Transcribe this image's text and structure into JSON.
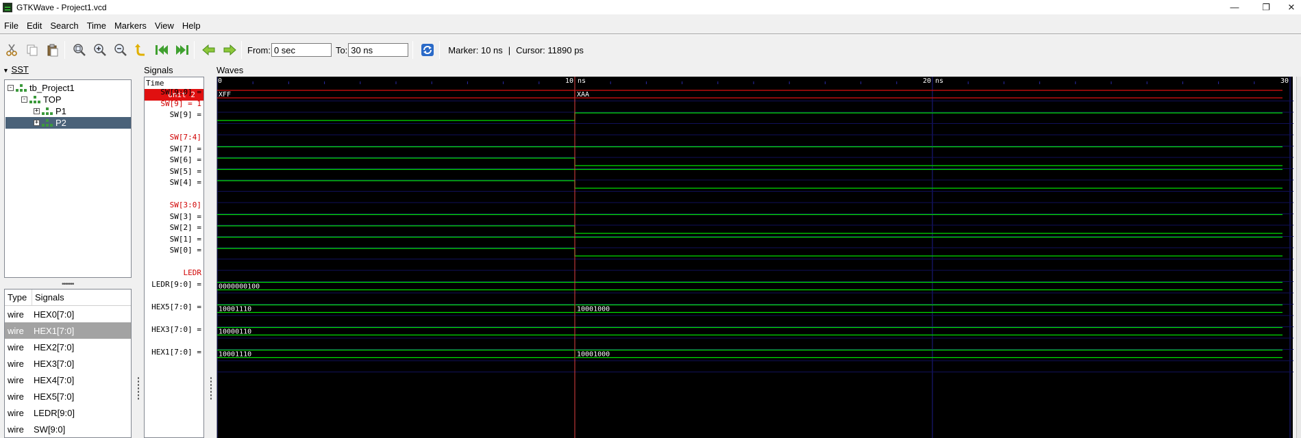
{
  "window": {
    "title": "GTKWave - Project1.vcd"
  },
  "menu": [
    "File",
    "Edit",
    "Search",
    "Time",
    "Markers",
    "View",
    "Help"
  ],
  "toolbar": {
    "from_label": "From:",
    "from_value": "0 sec",
    "to_label": "To:",
    "to_value": "30 ns",
    "marker_text": "Marker: 10 ns",
    "separator": "|",
    "cursor_text": "Cursor: 11890 ps",
    "icons": [
      "cut-icon",
      "copy-icon",
      "paste-icon",
      "zoom-fit-icon",
      "zoom-in-icon",
      "zoom-out-icon",
      "zoom-undo-icon",
      "zoom-to-start-icon",
      "zoom-to-end-icon",
      "find-previous-edge-icon",
      "find-next-edge-icon",
      "reload-icon"
    ]
  },
  "sst": {
    "header": "SST",
    "tree": [
      {
        "label": "tb_Project1",
        "level": 0,
        "expander": "-"
      },
      {
        "label": "TOP",
        "level": 1,
        "expander": "-"
      },
      {
        "label": "P1",
        "level": 2,
        "expander": "+"
      },
      {
        "label": "P2",
        "level": 2,
        "expander": "+",
        "selected": true
      }
    ],
    "columns": [
      "Type",
      "Signals"
    ],
    "signals": [
      {
        "type": "wire",
        "name": "HEX0[7:0]"
      },
      {
        "type": "wire",
        "name": "HEX1[7:0]",
        "selected": true
      },
      {
        "type": "wire",
        "name": "HEX2[7:0]"
      },
      {
        "type": "wire",
        "name": "HEX3[7:0]"
      },
      {
        "type": "wire",
        "name": "HEX4[7:0]"
      },
      {
        "type": "wire",
        "name": "HEX5[7:0]"
      },
      {
        "type": "wire",
        "name": "LEDR[9:0]"
      },
      {
        "type": "wire",
        "name": "SW[9:0]"
      }
    ]
  },
  "signals_pane": {
    "header": "Signals",
    "time_label": "Time",
    "unit_label": "Unit 2",
    "rows": [
      {
        "text": "SW[9:0] =",
        "red": false
      },
      {
        "text": "SW[9] = 1",
        "red": true
      },
      {
        "text": "SW[9] =",
        "red": false
      },
      {
        "text": "",
        "red": false
      },
      {
        "text": "SW[7:4]",
        "red": true
      },
      {
        "text": "SW[7] =",
        "red": false
      },
      {
        "text": "SW[6] =",
        "red": false
      },
      {
        "text": "SW[5] =",
        "red": false
      },
      {
        "text": "SW[4] =",
        "red": false
      },
      {
        "text": "",
        "red": false
      },
      {
        "text": "SW[3:0]",
        "red": true
      },
      {
        "text": "SW[3] =",
        "red": false
      },
      {
        "text": "SW[2] =",
        "red": false
      },
      {
        "text": "SW[1] =",
        "red": false
      },
      {
        "text": "SW[0] =",
        "red": false
      },
      {
        "text": "",
        "red": false
      },
      {
        "text": "LEDR",
        "red": true
      },
      {
        "text": "LEDR[9:0] =",
        "red": false
      },
      {
        "text": "",
        "red": false
      },
      {
        "text": "HEX5[7:0] =",
        "red": false
      },
      {
        "text": "",
        "red": false
      },
      {
        "text": "HEX3[7:0] =",
        "red": false
      },
      {
        "text": "",
        "red": false
      },
      {
        "text": "HEX1[7:0] =",
        "red": false
      }
    ]
  },
  "waves": {
    "header": "Waves",
    "time_ticks": [
      {
        "t": 0,
        "label": "0"
      },
      {
        "t": 10,
        "label": "10 ns"
      },
      {
        "t": 20,
        "label": "20 ns"
      },
      {
        "t": 30,
        "label": "30"
      }
    ],
    "time_range": [
      0,
      30
    ],
    "marker_time": 10,
    "colors": {
      "wave": "#00e000",
      "bus": "#e01010",
      "marker": "#e04040",
      "grid": "#1c1c8c",
      "text": "#ffffff"
    },
    "traces": [
      {
        "row": 0,
        "kind": "bus",
        "segments": [
          {
            "t": 0,
            "label": "XFF"
          },
          {
            "t": 10,
            "label": "XAA"
          }
        ],
        "color": "bus"
      },
      {
        "row": 2,
        "kind": "bit",
        "levels": [
          {
            "t": 0,
            "v": 0
          },
          {
            "t": 10,
            "v": 1
          }
        ]
      },
      {
        "row": 5,
        "kind": "bit",
        "levels": [
          {
            "t": 0,
            "v": 1
          }
        ]
      },
      {
        "row": 6,
        "kind": "bit",
        "levels": [
          {
            "t": 0,
            "v": 1
          },
          {
            "t": 10,
            "v": 0
          }
        ]
      },
      {
        "row": 7,
        "kind": "bit",
        "levels": [
          {
            "t": 0,
            "v": 1
          }
        ]
      },
      {
        "row": 8,
        "kind": "bit",
        "levels": [
          {
            "t": 0,
            "v": 1
          },
          {
            "t": 10,
            "v": 0
          }
        ]
      },
      {
        "row": 11,
        "kind": "bit",
        "levels": [
          {
            "t": 0,
            "v": 1
          }
        ]
      },
      {
        "row": 12,
        "kind": "bit",
        "levels": [
          {
            "t": 0,
            "v": 1
          },
          {
            "t": 10,
            "v": 0
          }
        ]
      },
      {
        "row": 13,
        "kind": "bit",
        "levels": [
          {
            "t": 0,
            "v": 1
          }
        ]
      },
      {
        "row": 14,
        "kind": "bit",
        "levels": [
          {
            "t": 0,
            "v": 1
          },
          {
            "t": 10,
            "v": 0
          }
        ]
      },
      {
        "row": 17,
        "kind": "bus",
        "segments": [
          {
            "t": 0,
            "label": "0000000100"
          }
        ],
        "color": "wave"
      },
      {
        "row": 19,
        "kind": "bus",
        "segments": [
          {
            "t": 0,
            "label": "10001110"
          },
          {
            "t": 10,
            "label": "10001000"
          }
        ],
        "color": "wave"
      },
      {
        "row": 21,
        "kind": "bus",
        "segments": [
          {
            "t": 0,
            "label": "10000110"
          }
        ],
        "color": "wave"
      },
      {
        "row": 23,
        "kind": "bus",
        "segments": [
          {
            "t": 0,
            "label": "10001110"
          },
          {
            "t": 10,
            "label": "10001000"
          }
        ],
        "color": "wave"
      }
    ]
  }
}
